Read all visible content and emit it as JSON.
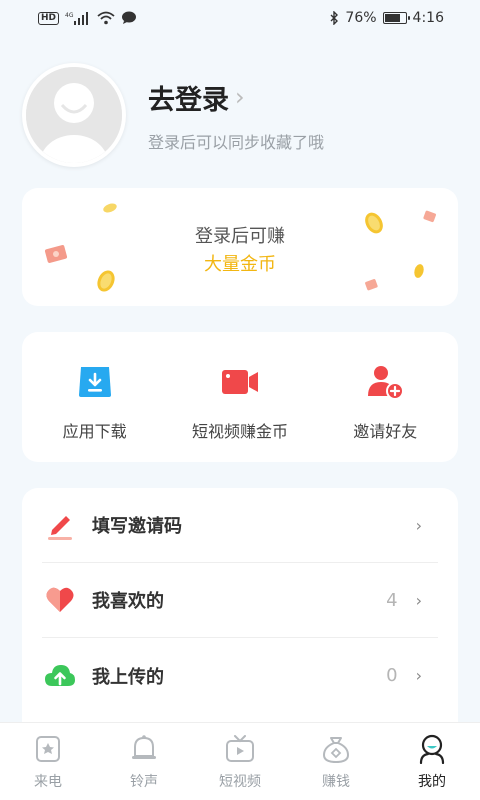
{
  "status_bar": {
    "hd": "HD",
    "network": "4G",
    "battery_text": "76%",
    "battery_level": 0.76,
    "time": "4:16"
  },
  "profile": {
    "login_title": "去登录",
    "login_chevron": "›",
    "login_subtitle": "登录后可以同步收藏了哦"
  },
  "earn_card": {
    "line1": "登录后可赚",
    "line2": "大量金币",
    "accent_color": "#f2b612"
  },
  "tools": [
    {
      "label": "应用下载",
      "icon": "download-icon",
      "color": "#27a9f0"
    },
    {
      "label": "短视频赚金币",
      "icon": "video-camera-icon",
      "color": "#f0484a"
    },
    {
      "label": "邀请好友",
      "icon": "add-friend-icon",
      "color": "#f0484a"
    }
  ],
  "list": [
    {
      "label": "填写邀请码",
      "count": "",
      "chevron": "›",
      "icon": "pencil-icon"
    },
    {
      "label": "我喜欢的",
      "count": "4",
      "chevron": "›",
      "icon": "heart-icon"
    },
    {
      "label": "我上传的",
      "count": "0",
      "chevron": "›",
      "icon": "cloud-upload-icon"
    }
  ],
  "bottom_nav": [
    {
      "label": "来电",
      "icon": "phone-frame-icon",
      "active": false
    },
    {
      "label": "铃声",
      "icon": "bell-icon",
      "active": false
    },
    {
      "label": "短视频",
      "icon": "tv-play-icon",
      "active": false
    },
    {
      "label": "赚钱",
      "icon": "money-bag-icon",
      "active": false
    },
    {
      "label": "我的",
      "icon": "profile-icon",
      "active": true
    }
  ]
}
